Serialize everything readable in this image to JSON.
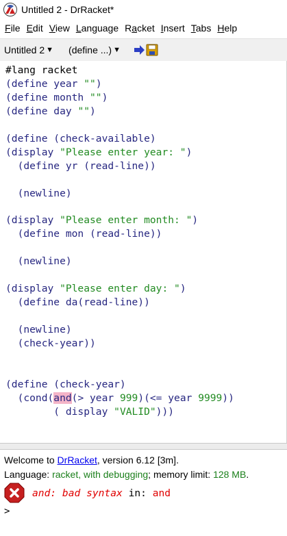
{
  "window": {
    "title": "Untitled 2 - DrRacket*"
  },
  "menubar": [
    {
      "mnemonic": "F",
      "rest": "ile"
    },
    {
      "mnemonic": "E",
      "rest": "dit"
    },
    {
      "mnemonic": "V",
      "rest": "iew"
    },
    {
      "mnemonic": "L",
      "rest": "anguage"
    },
    {
      "pre": "R",
      "mnemonic": "a",
      "rest": "cket"
    },
    {
      "mnemonic": "I",
      "rest": "nsert"
    },
    {
      "mnemonic": "T",
      "rest": "abs"
    },
    {
      "mnemonic": "H",
      "rest": "elp"
    }
  ],
  "toolbar": {
    "file_menu_label": "Untitled 2",
    "defs_menu_label": "(define ...)"
  },
  "editor": {
    "lines": [
      [
        {
          "t": "#lang racket",
          "c": "plain"
        }
      ],
      [
        {
          "t": "(define year ",
          "c": "kw"
        },
        {
          "t": "\"\"",
          "c": "str"
        },
        {
          "t": ")",
          "c": "kw"
        }
      ],
      [
        {
          "t": "(define month ",
          "c": "kw"
        },
        {
          "t": "\"\"",
          "c": "str"
        },
        {
          "t": ")",
          "c": "kw"
        }
      ],
      [
        {
          "t": "(define day ",
          "c": "kw"
        },
        {
          "t": "\"\"",
          "c": "str"
        },
        {
          "t": ")",
          "c": "kw"
        }
      ],
      [],
      [
        {
          "t": "(define (check-available)",
          "c": "kw"
        }
      ],
      [
        {
          "t": "(display ",
          "c": "kw"
        },
        {
          "t": "\"Please enter year: \"",
          "c": "str"
        },
        {
          "t": ")",
          "c": "kw"
        }
      ],
      [
        {
          "t": "  (define yr (read-line))",
          "c": "kw"
        }
      ],
      [],
      [
        {
          "t": "  (newline)",
          "c": "kw"
        }
      ],
      [],
      [
        {
          "t": "(display ",
          "c": "kw"
        },
        {
          "t": "\"Please enter month: \"",
          "c": "str"
        },
        {
          "t": ")",
          "c": "kw"
        }
      ],
      [
        {
          "t": "  (define mon (read-line))",
          "c": "kw"
        }
      ],
      [],
      [
        {
          "t": "  (newline)",
          "c": "kw"
        }
      ],
      [],
      [
        {
          "t": "(display ",
          "c": "kw"
        },
        {
          "t": "\"Please enter day: \"",
          "c": "str"
        },
        {
          "t": ")",
          "c": "kw"
        }
      ],
      [
        {
          "t": "  (define da(read-line))",
          "c": "kw"
        }
      ],
      [],
      [
        {
          "t": "  (newline)",
          "c": "kw"
        }
      ],
      [
        {
          "t": "  (check-year))",
          "c": "kw"
        }
      ],
      [],
      [],
      [
        {
          "t": "(define (check-year)",
          "c": "kw"
        }
      ],
      [
        {
          "t": "  (cond(",
          "c": "kw"
        },
        {
          "t": "and",
          "c": "hl"
        },
        {
          "t": "(> year ",
          "c": "kw"
        },
        {
          "t": "999",
          "c": "num"
        },
        {
          "t": ")(<= year ",
          "c": "kw"
        },
        {
          "t": "9999",
          "c": "num"
        },
        {
          "t": "))",
          "c": "kw"
        }
      ],
      [
        {
          "t": "        ( display ",
          "c": "kw"
        },
        {
          "t": "\"VALID\"",
          "c": "str"
        },
        {
          "t": ")))",
          "c": "kw"
        }
      ]
    ]
  },
  "interactions": {
    "welcome_prefix": "Welcome to ",
    "welcome_link": "DrRacket",
    "welcome_suffix": ", version 6.12 [3m].",
    "lang_prefix": "Language: ",
    "lang_name": "racket, with debugging",
    "lang_mid": "; memory limit: ",
    "mem_limit": "128 MB",
    "lang_end": ".",
    "error_part1": "and: bad syntax",
    "error_part2": " in: ",
    "error_part3": "and",
    "prompt": ">"
  },
  "colors": {
    "keyword": "#262680",
    "string": "#228b22",
    "highlight": "#f4b4c8",
    "error": "#e00000",
    "link": "#0000ee"
  },
  "icons": [
    "racket-logo-icon",
    "run-arrow-icon",
    "save-disk-icon",
    "error-x-icon"
  ]
}
